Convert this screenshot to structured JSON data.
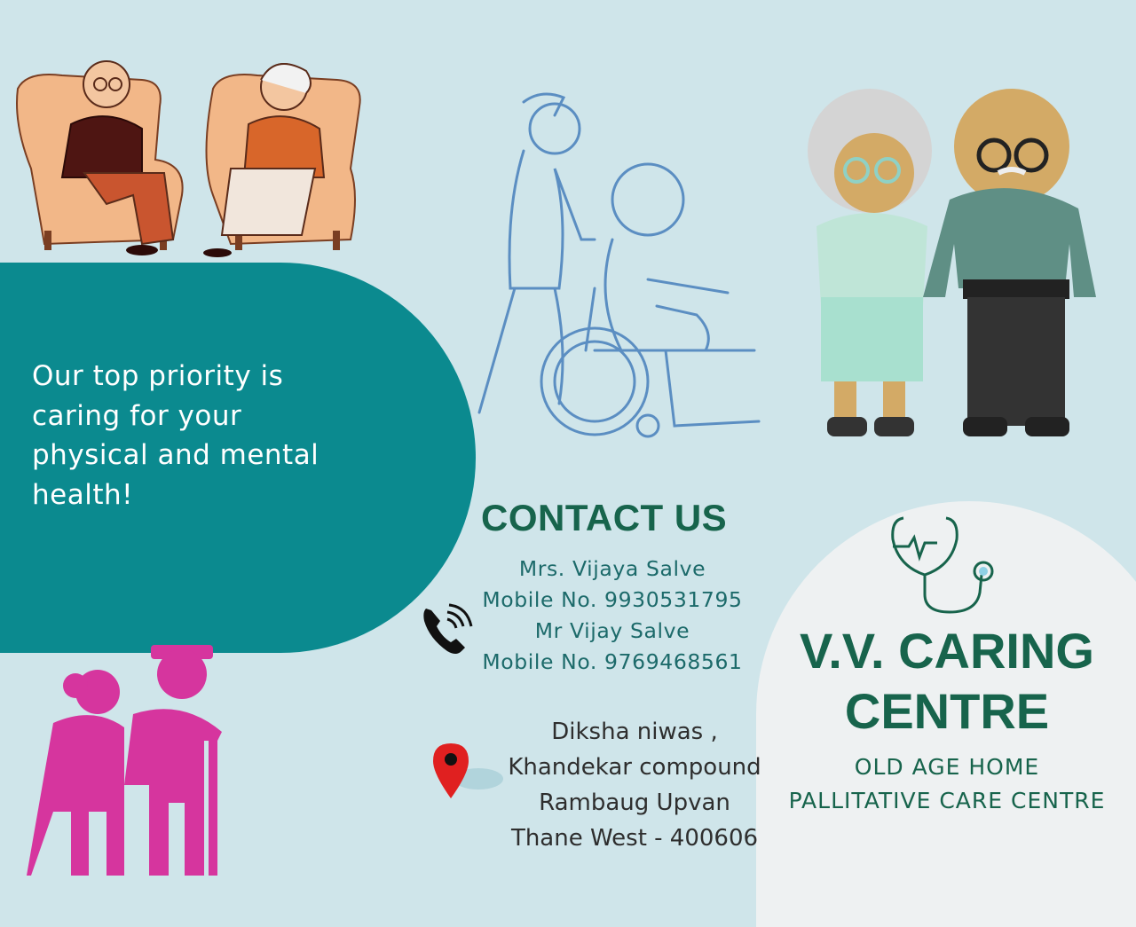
{
  "tagline": "Our top priority is caring for your physical and mental health!",
  "contact": {
    "heading": "CONTACT US",
    "lines": [
      "Mrs. Vijaya Salve",
      "Mobile No. 9930531795",
      "Mr Vijay Salve",
      "Mobile No. 9769468561"
    ],
    "address": [
      "Diksha niwas ,",
      "Khandekar compound",
      "Rambaug Upvan",
      "Thane West - 400606"
    ]
  },
  "centre": {
    "name_line1": "V.V. CARING",
    "name_line2": "CENTRE",
    "sub1": "OLD AGE HOME",
    "sub2": "PALLITATIVE CARE CENTRE"
  },
  "colors": {
    "background": "#cfe5ea",
    "teal": "#0b8a8f",
    "dark_green": "#17644c",
    "magenta": "#d6359e"
  },
  "icons": [
    "elderly-couple-armchairs-illustration",
    "nurse-wheelchair-sketch",
    "elderly-couple-standing-illustration",
    "elderly-couple-silhouette-icon",
    "phone-icon",
    "map-pin-icon",
    "stethoscope-icon"
  ]
}
